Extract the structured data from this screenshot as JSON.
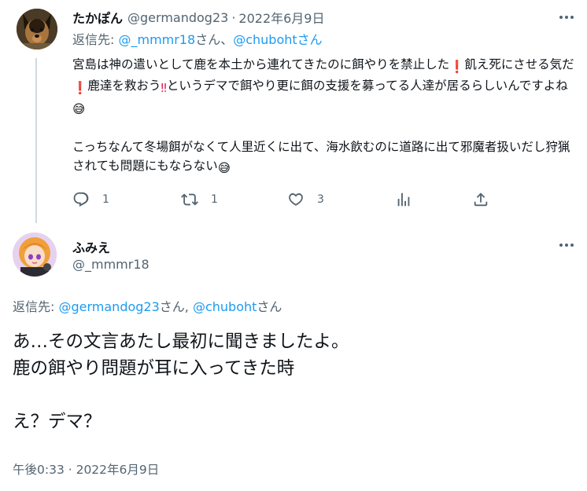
{
  "parent_tweet": {
    "display_name": "たかぽん",
    "handle": "@germandog23",
    "separator": "·",
    "date": "2022年6月9日",
    "reply_to_prefix": "返信先: ",
    "reply_to_user1": "@_mmmr18",
    "reply_to_san1": "さん、",
    "reply_to_user2": "@chubohtさん",
    "text_para1_a": "宮島は神の遣いとして鹿を本土から連れてきたのに餌やりを禁止した",
    "text_para1_b": "飢え死にさせる気だ",
    "text_para1_c": "鹿達を救おう",
    "text_para1_d": "というデマで餌やり更に餌の支援を募ってる人達が居るらしいんですよね",
    "text_para2": "こっちなんて冬場餌がなくて人里近くに出て、海水飲むのに道路に出て邪魔者扱いだし狩猟されても問題にもならない",
    "emoji_exclaim": "❗",
    "emoji_double_exclaim": "‼",
    "emoji_sweat": "😅",
    "reply_count": "1",
    "retweet_count": "1",
    "like_count": "3"
  },
  "focused_tweet": {
    "display_name": "ふみえ",
    "handle": "@_mmmr18",
    "reply_to_prefix": "返信先: ",
    "reply_to_user1": "@germandog23",
    "reply_to_san1": "さん, ",
    "reply_to_user2": "@chuboht",
    "reply_to_san2": "さん",
    "text_line1": "あ…その文言あたし最初に聞きましたよ。",
    "text_line2": "鹿の餌やり問題が耳に入ってきた時",
    "text_line3": "え？デマ？",
    "timestamp": "午後0:33 · 2022年6月9日"
  },
  "colors": {
    "link": "#1d9bf0",
    "secondary_text": "#536471",
    "primary_text": "#0f1419",
    "thread_line": "#cfd9de"
  }
}
